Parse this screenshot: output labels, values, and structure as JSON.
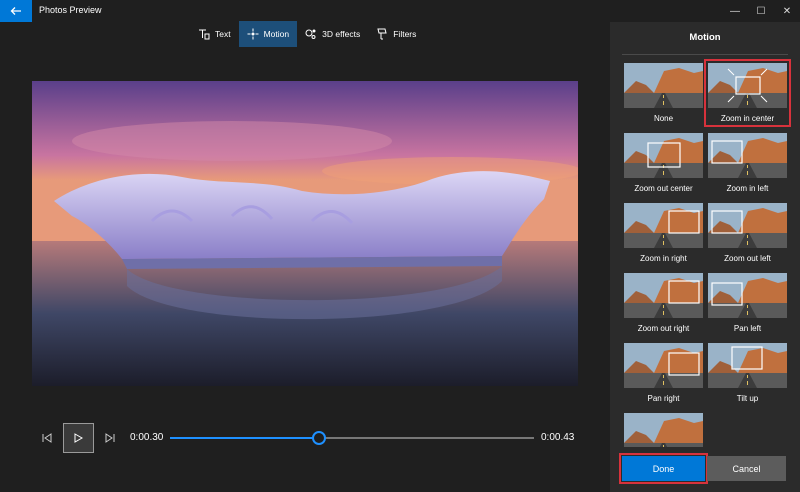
{
  "app": {
    "title": "Photos Preview"
  },
  "window_controls": {
    "minimize": "—",
    "maximize": "☐",
    "close": "✕"
  },
  "toolbar": {
    "items": [
      {
        "label": "Text",
        "icon": "text-icon"
      },
      {
        "label": "Motion",
        "icon": "motion-icon",
        "active": true
      },
      {
        "label": "3D effects",
        "icon": "3d-effects-icon"
      },
      {
        "label": "Filters",
        "icon": "filters-icon"
      }
    ]
  },
  "playback": {
    "current_time": "0:00.30",
    "total_time": "0:00.43",
    "progress": 0.41
  },
  "panel": {
    "title": "Motion",
    "options": [
      {
        "label": "None"
      },
      {
        "label": "Zoom in center",
        "selected": true
      },
      {
        "label": "Zoom out center"
      },
      {
        "label": "Zoom in left"
      },
      {
        "label": "Zoom in right"
      },
      {
        "label": "Zoom out left"
      },
      {
        "label": "Zoom out right"
      },
      {
        "label": "Pan left"
      },
      {
        "label": "Pan right"
      },
      {
        "label": "Tilt up"
      },
      {
        "label": ""
      }
    ],
    "done_label": "Done",
    "cancel_label": "Cancel"
  },
  "colors": {
    "accent": "#0078d7",
    "selection": "#d7323c",
    "panel_bg": "#2b2b2b",
    "app_bg": "#1f1f1f"
  }
}
